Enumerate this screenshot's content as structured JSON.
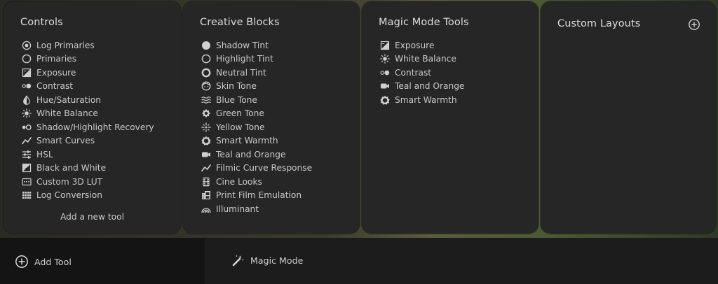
{
  "panels": {
    "controls": {
      "title": "Controls",
      "items": [
        {
          "label": "Log Primaries",
          "icon": "log-primaries-icon"
        },
        {
          "label": "Primaries",
          "icon": "primaries-icon"
        },
        {
          "label": "Exposure",
          "icon": "exposure-icon"
        },
        {
          "label": "Contrast",
          "icon": "contrast-icon"
        },
        {
          "label": "Hue/Saturation",
          "icon": "hue-saturation-icon"
        },
        {
          "label": "White Balance",
          "icon": "white-balance-icon"
        },
        {
          "label": "Shadow/Highlight Recovery",
          "icon": "shadow-highlight-icon"
        },
        {
          "label": "Smart Curves",
          "icon": "curve-icon"
        },
        {
          "label": "HSL",
          "icon": "hsl-sliders-icon"
        },
        {
          "label": "Black and White",
          "icon": "black-white-icon"
        },
        {
          "label": "Custom 3D LUT",
          "icon": "lut-icon"
        },
        {
          "label": "Log Conversion",
          "icon": "log-conversion-icon"
        }
      ],
      "add_new_label": "Add a new tool"
    },
    "creative": {
      "title": "Creative Blocks",
      "items": [
        {
          "label": "Shadow Tint",
          "icon": "shadow-tint-icon"
        },
        {
          "label": "Highlight Tint",
          "icon": "highlight-tint-icon"
        },
        {
          "label": "Neutral Tint",
          "icon": "neutral-tint-icon"
        },
        {
          "label": "Skin Tone",
          "icon": "skin-tone-icon"
        },
        {
          "label": "Blue Tone",
          "icon": "blue-tone-icon"
        },
        {
          "label": "Green Tone",
          "icon": "green-tone-icon"
        },
        {
          "label": "Yellow Tone",
          "icon": "yellow-tone-icon"
        },
        {
          "label": "Smart Warmth",
          "icon": "smart-warmth-icon"
        },
        {
          "label": "Teal and Orange",
          "icon": "camera-icon"
        },
        {
          "label": "Filmic Curve Response",
          "icon": "curve-icon"
        },
        {
          "label": "Cine Looks",
          "icon": "film-icon"
        },
        {
          "label": "Print Film Emulation",
          "icon": "print-film-icon"
        },
        {
          "label": "Illuminant",
          "icon": "illuminant-icon"
        }
      ]
    },
    "magic": {
      "title": "Magic Mode Tools",
      "items": [
        {
          "label": "Exposure",
          "icon": "exposure-icon"
        },
        {
          "label": "White Balance",
          "icon": "white-balance-icon"
        },
        {
          "label": "Contrast",
          "icon": "contrast-icon"
        },
        {
          "label": "Teal and Orange",
          "icon": "camera-icon"
        },
        {
          "label": "Smart Warmth",
          "icon": "smart-warmth-icon"
        }
      ]
    },
    "custom": {
      "title": "Custom Layouts"
    }
  },
  "bottom_bar": {
    "add_tool_label": "Add Tool",
    "magic_mode_label": "Magic Mode"
  }
}
